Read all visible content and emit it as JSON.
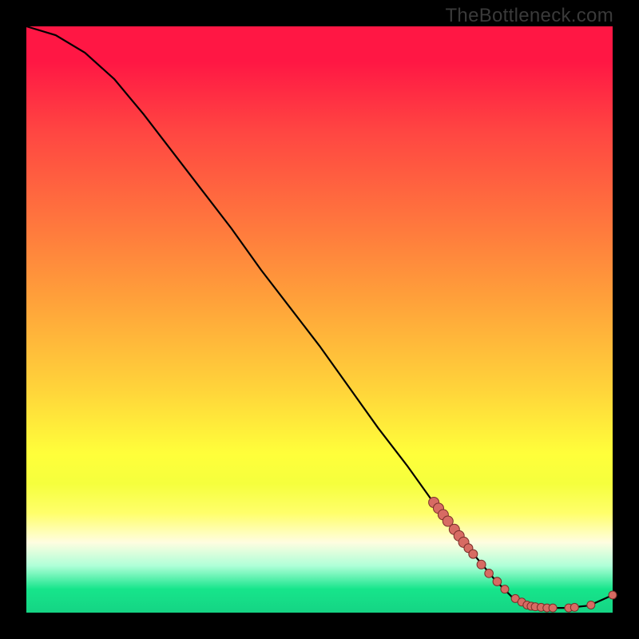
{
  "watermark": "TheBottleneck.com",
  "colors": {
    "point_fill": "#d76b63",
    "point_stroke": "#7b2f2a",
    "curve": "#000000"
  },
  "chart_data": {
    "type": "line",
    "title": "",
    "xlabel": "",
    "ylabel": "",
    "xlim": [
      0,
      100
    ],
    "ylim": [
      0,
      100
    ],
    "curve": [
      {
        "x": 0,
        "y": 100
      },
      {
        "x": 5,
        "y": 98.5
      },
      {
        "x": 10,
        "y": 95.5
      },
      {
        "x": 15,
        "y": 91
      },
      {
        "x": 20,
        "y": 85
      },
      {
        "x": 25,
        "y": 78.5
      },
      {
        "x": 30,
        "y": 72
      },
      {
        "x": 35,
        "y": 65.5
      },
      {
        "x": 40,
        "y": 58.5
      },
      {
        "x": 45,
        "y": 52
      },
      {
        "x": 50,
        "y": 45.5
      },
      {
        "x": 55,
        "y": 38.5
      },
      {
        "x": 60,
        "y": 31.5
      },
      {
        "x": 65,
        "y": 25
      },
      {
        "x": 70,
        "y": 18
      },
      {
        "x": 75,
        "y": 11.5
      },
      {
        "x": 80,
        "y": 5.5
      },
      {
        "x": 83,
        "y": 2.5
      },
      {
        "x": 85,
        "y": 1.2
      },
      {
        "x": 88,
        "y": 0.8
      },
      {
        "x": 92,
        "y": 0.8
      },
      {
        "x": 96,
        "y": 1.2
      },
      {
        "x": 100,
        "y": 3.0
      }
    ],
    "points": [
      {
        "x": 69.5,
        "y": 18.8,
        "r": 6.5
      },
      {
        "x": 70.3,
        "y": 17.8,
        "r": 6.5
      },
      {
        "x": 71.1,
        "y": 16.7,
        "r": 6.5
      },
      {
        "x": 71.9,
        "y": 15.6,
        "r": 6.5
      },
      {
        "x": 73.0,
        "y": 14.2,
        "r": 6.5
      },
      {
        "x": 73.8,
        "y": 13.1,
        "r": 6.5
      },
      {
        "x": 74.6,
        "y": 12.0,
        "r": 6.5
      },
      {
        "x": 75.4,
        "y": 11.0,
        "r": 5.5
      },
      {
        "x": 76.2,
        "y": 10.0,
        "r": 5.5
      },
      {
        "x": 77.6,
        "y": 8.2,
        "r": 5.5
      },
      {
        "x": 78.9,
        "y": 6.7,
        "r": 5.3
      },
      {
        "x": 80.3,
        "y": 5.3,
        "r": 5.3
      },
      {
        "x": 81.6,
        "y": 4.0,
        "r": 5.0
      },
      {
        "x": 83.4,
        "y": 2.4,
        "r": 5.0
      },
      {
        "x": 84.5,
        "y": 1.8,
        "r": 5.0
      },
      {
        "x": 85.4,
        "y": 1.3,
        "r": 5.0
      },
      {
        "x": 86.1,
        "y": 1.1,
        "r": 5.0
      },
      {
        "x": 86.8,
        "y": 1.0,
        "r": 5.0
      },
      {
        "x": 87.8,
        "y": 0.9,
        "r": 5.0
      },
      {
        "x": 88.8,
        "y": 0.8,
        "r": 5.0
      },
      {
        "x": 89.8,
        "y": 0.8,
        "r": 5.0
      },
      {
        "x": 92.5,
        "y": 0.8,
        "r": 5.0
      },
      {
        "x": 93.5,
        "y": 0.9,
        "r": 5.0
      },
      {
        "x": 96.3,
        "y": 1.3,
        "r": 5.0
      },
      {
        "x": 100,
        "y": 3.0,
        "r": 5.0
      }
    ]
  }
}
